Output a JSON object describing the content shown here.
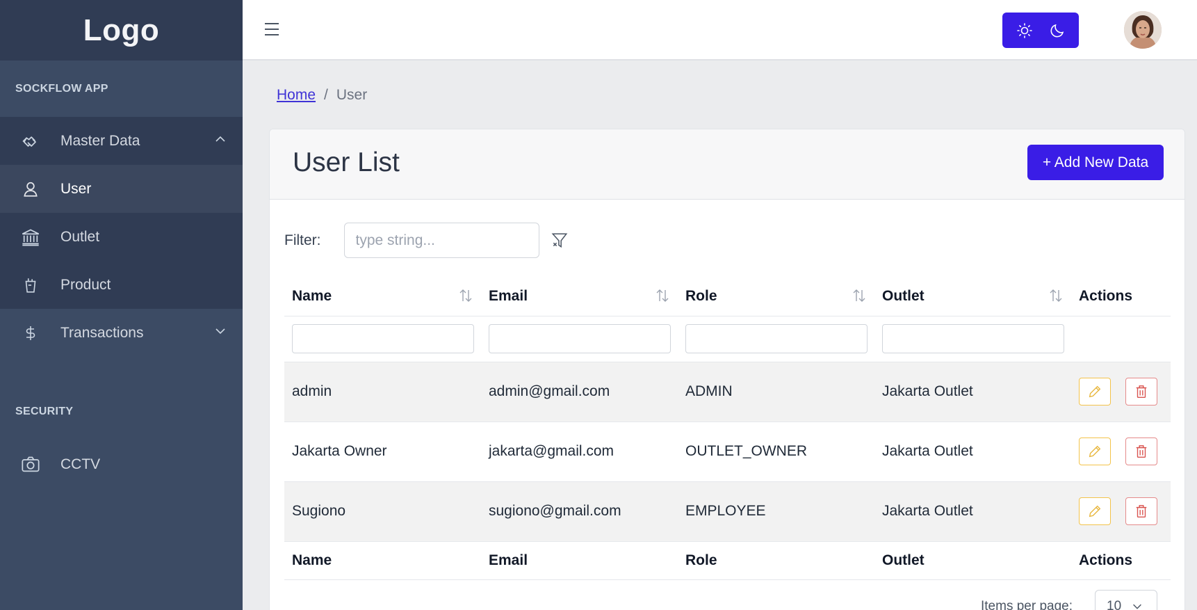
{
  "sidebar": {
    "logo": "Logo",
    "section_app": "SOCKFLOW APP",
    "section_security": "SECURITY",
    "items": [
      {
        "label": "Master Data",
        "icon": "handshake-icon"
      },
      {
        "label": "User",
        "icon": "user-icon"
      },
      {
        "label": "Outlet",
        "icon": "bank-icon"
      },
      {
        "label": "Product",
        "icon": "cup-icon"
      },
      {
        "label": "Transactions",
        "icon": "dollar-icon"
      },
      {
        "label": "CCTV",
        "icon": "camera-icon"
      }
    ]
  },
  "header": {
    "menu_icon": "hamburger-icon",
    "light_icon": "sun-icon",
    "dark_icon": "moon-icon"
  },
  "breadcrumb": {
    "home": "Home",
    "separator": "/",
    "current": "User"
  },
  "card": {
    "title": "User List",
    "add_button": "+ Add New Data"
  },
  "filter": {
    "label": "Filter:",
    "placeholder": "type string..."
  },
  "table": {
    "columns": [
      "Name",
      "Email",
      "Role",
      "Outlet",
      "Actions"
    ],
    "rows": [
      {
        "name": "admin",
        "email": "admin@gmail.com",
        "role": "ADMIN",
        "outlet": "Jakarta Outlet"
      },
      {
        "name": "Jakarta Owner",
        "email": "jakarta@gmail.com",
        "role": "OUTLET_OWNER",
        "outlet": "Jakarta Outlet"
      },
      {
        "name": "Sugiono",
        "email": "sugiono@gmail.com",
        "role": "EMPLOYEE",
        "outlet": "Jakarta Outlet"
      }
    ]
  },
  "pagination": {
    "label": "Items per page:",
    "value": "10"
  },
  "colors": {
    "sidebar": "#3c4b64",
    "accent": "#3a1de6",
    "edit": "#f3c34a",
    "delete": "#e58a8a"
  }
}
